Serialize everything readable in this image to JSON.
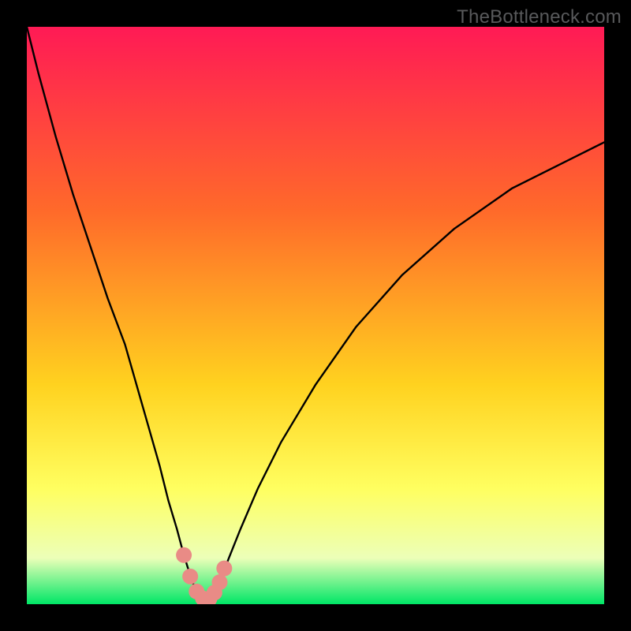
{
  "watermark": "TheBottleneck.com",
  "colors": {
    "bg": "#000000",
    "gradient_top": "#ff1a55",
    "gradient_mid1": "#ff6a2a",
    "gradient_mid2": "#ffd21f",
    "gradient_mid3": "#ffff60",
    "gradient_mid4": "#ecffb8",
    "gradient_bottom": "#00e666",
    "curve": "#000000",
    "marker": "#e98b86"
  },
  "chart_data": {
    "type": "line",
    "title": "",
    "xlabel": "",
    "ylabel": "",
    "xlim": [
      0,
      100
    ],
    "ylim": [
      0,
      100
    ],
    "series": [
      {
        "name": "bottleneck-curve",
        "x": [
          0,
          2,
          5,
          8,
          11,
          14,
          17,
          19,
          21,
          23,
          24.5,
          26,
          27.2,
          28.3,
          29.2,
          30,
          30.8,
          31.6,
          32.5,
          33.5,
          35,
          37,
          40,
          44,
          50,
          57,
          65,
          74,
          84,
          94,
          100
        ],
        "y": [
          100,
          92,
          81,
          71,
          62,
          53,
          45,
          38,
          31,
          24,
          18,
          13,
          8.5,
          5,
          2.5,
          1.2,
          0.6,
          0.9,
          2.0,
          4.2,
          8,
          13,
          20,
          28,
          38,
          48,
          57,
          65,
          72,
          77,
          80
        ]
      }
    ],
    "markers": {
      "name": "highlight-points",
      "x": [
        27.2,
        28.3,
        29.4,
        30.5,
        31.6,
        32.5,
        33.4,
        34.2
      ],
      "y": [
        8.5,
        4.8,
        2.2,
        1.0,
        0.9,
        2.0,
        3.8,
        6.2
      ]
    }
  }
}
